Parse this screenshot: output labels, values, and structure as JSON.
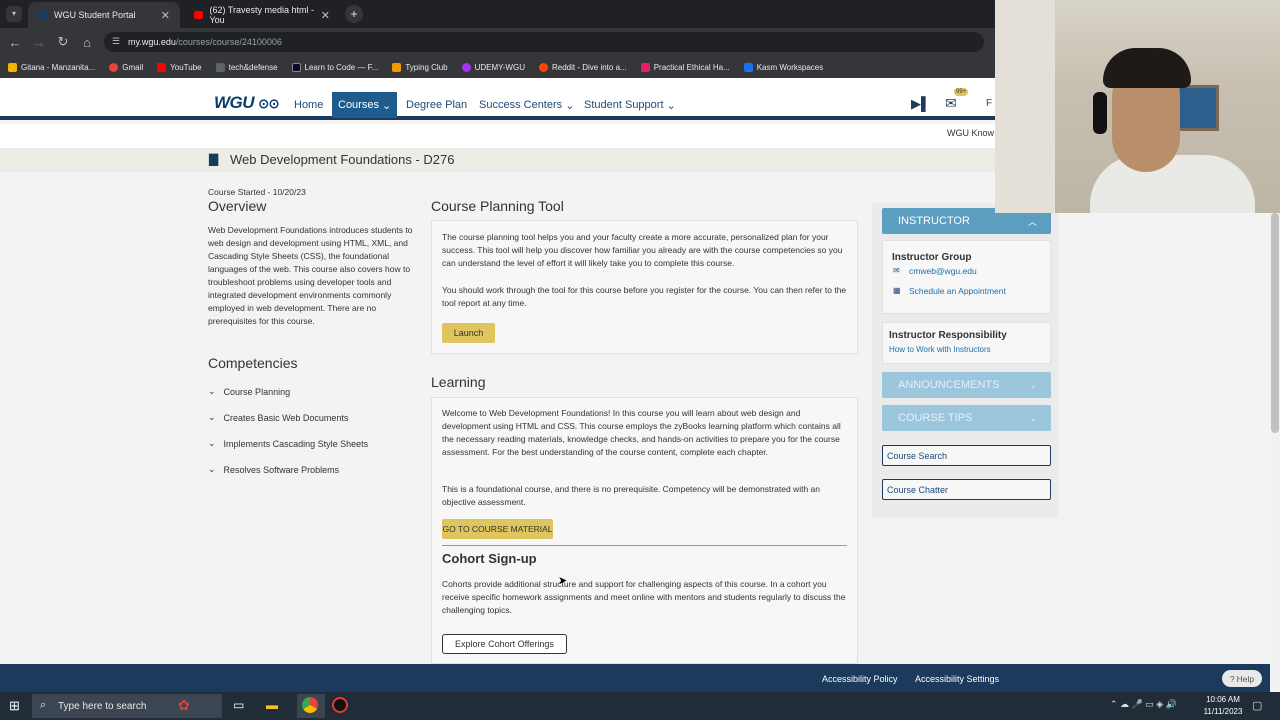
{
  "browser": {
    "tabs": [
      {
        "label": "WGU Student Portal",
        "active": true
      },
      {
        "label": "(62) Travesty media html - You",
        "active": false
      }
    ],
    "url_host": "my.wgu.edu",
    "url_path": "/courses/course/24100006",
    "bookmarks": [
      {
        "label": "Gitana - Manzanita...",
        "color": "#f4b400"
      },
      {
        "label": "Gmail",
        "color": "#ea4335"
      },
      {
        "label": "YouTube",
        "color": "#ff0000"
      },
      {
        "label": "tech&defense",
        "color": "#5f6368"
      },
      {
        "label": "Learn to Code — F...",
        "color": "#0a0a23"
      },
      {
        "label": "Typing Club",
        "color": "#f29900"
      },
      {
        "label": "UDEMY-WGU",
        "color": "#a435f0"
      },
      {
        "label": "Reddit - Dive into a...",
        "color": "#ff4500"
      },
      {
        "label": "Practical Ethical Ha...",
        "color": "#e91e63"
      },
      {
        "label": "Kasm Workspaces",
        "color": "#1a73e8"
      }
    ]
  },
  "header": {
    "logo": "WGU",
    "nav": [
      {
        "label": "Home",
        "active": false
      },
      {
        "label": "Courses",
        "active": true
      },
      {
        "label": "Degree Plan",
        "active": false
      },
      {
        "label": "Success Centers",
        "active": false
      },
      {
        "label": "Student Support",
        "active": false
      }
    ],
    "badge": "99+",
    "profile_initial": "F",
    "knowledge": "WGU Know"
  },
  "course": {
    "title": "Web Development Foundations - D276",
    "started": "Course Started - 10/20/23",
    "overview_heading": "Overview",
    "overview_text": "Web Development Foundations introduces students to web design and development using HTML, XML, and Cascading Style Sheets (CSS), the foundational languages of the web. This course also covers how to troubleshoot problems using developer tools and integrated development environments commonly employed in web development. There are no prerequisites for this course.",
    "competencies_heading": "Competencies",
    "competencies": [
      "Course Planning",
      "Creates Basic Web Documents",
      "Implements Cascading Style Sheets",
      "Resolves Software Problems"
    ]
  },
  "planning": {
    "heading": "Course Planning Tool",
    "text1": "The course planning tool helps you and your faculty create a more accurate, personalized plan for your success. This tool will help you discover how familiar you already are with the course competencies so you can understand the level of effort it will likely take you to complete this course.",
    "text2": "You should work through the tool for this course before you register for the course. You can then refer to the tool report at any time.",
    "launch_label": "Launch"
  },
  "learning": {
    "heading": "Learning",
    "text1": "Welcome to Web Development Foundations! In this course you will learn about web design and development using HTML and CSS. This course employs the zyBooks learning platform which contains all the necessary reading materials, knowledge checks, and hands-on activities to prepare you for the course assessment. For the best understanding of the course content, complete each chapter.",
    "text2": "This is a foundational course, and there is no prerequisite. Competency will be demonstrated with an objective assessment.",
    "material_label": "GO TO COURSE MATERIAL",
    "cohort_heading": "Cohort Sign-up",
    "cohort_text": "Cohorts provide additional structure and support for challenging aspects of this course. In a cohort you receive specific homework assignments and meet online with mentors and students regularly to discuss the challenging topics.",
    "cohort_button": "Explore Cohort Offerings"
  },
  "sidebar": {
    "instructor_heading": "INSTRUCTOR",
    "group_title": "Instructor Group",
    "email": "cmweb@wgu.edu",
    "schedule": "Schedule an Appointment",
    "responsibility_title": "Instructor Responsibility",
    "responsibility_link": "How to Work with Instructors",
    "announcements": "ANNOUNCEMENTS",
    "tips": "COURSE TIPS",
    "search": "Course Search",
    "chatter": "Course Chatter"
  },
  "footer": {
    "policy": "Accessibility Policy",
    "settings": "Accessibility Settings",
    "help": "Help"
  },
  "taskbar": {
    "search_placeholder": "Type here to search",
    "time": "10:06 AM",
    "date": "11/11/2023"
  }
}
